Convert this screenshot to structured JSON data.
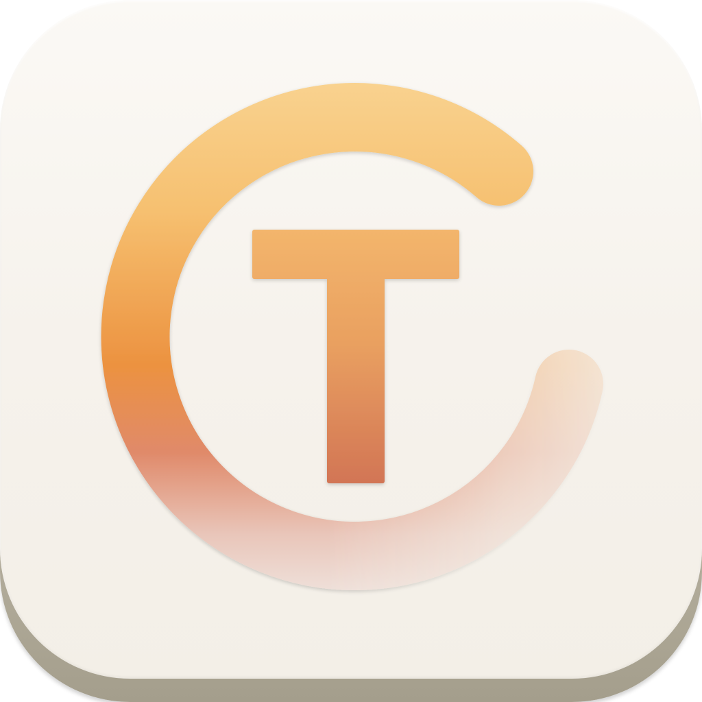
{
  "app_icon": {
    "glyph": "T",
    "icon_names": [
      "ring-arc-icon",
      "letter-t-icon"
    ],
    "colors": {
      "face_top": "#fbf9f5",
      "face_bottom": "#f3efe7",
      "base_edge": "#b9b3a2",
      "ring_top": "#f9d28f",
      "ring_mid": "#ec9240",
      "ring_low": "#e08a6a",
      "ring_fade": "#efe2dc",
      "t_top": "#f3b56c",
      "t_bottom": "#d27555"
    }
  }
}
